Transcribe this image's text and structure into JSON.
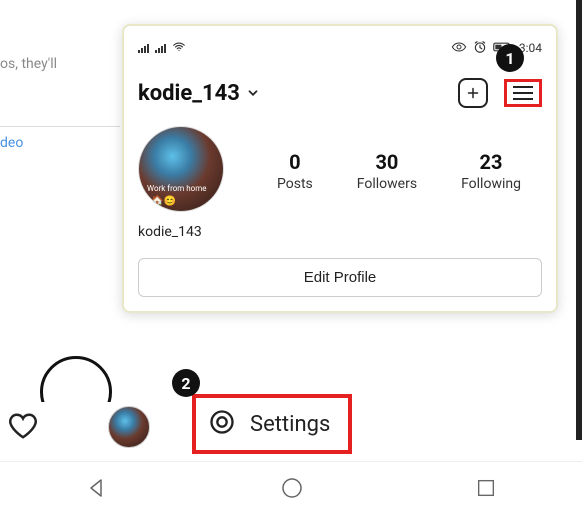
{
  "background": {
    "text1": "os, they'll",
    "text2": "deo"
  },
  "statusbar": {
    "time": "3:04"
  },
  "profile": {
    "username": "kodie_143",
    "display_name": "kodie_143",
    "avatar_overlay": "Work from home",
    "avatar_emoji": "🏠😊",
    "stats": [
      {
        "num": "0",
        "label": "Posts"
      },
      {
        "num": "30",
        "label": "Followers"
      },
      {
        "num": "23",
        "label": "Following"
      }
    ],
    "edit_label": "Edit Profile"
  },
  "callouts": {
    "one": "1",
    "two": "2"
  },
  "settings": {
    "label": "Settings"
  }
}
